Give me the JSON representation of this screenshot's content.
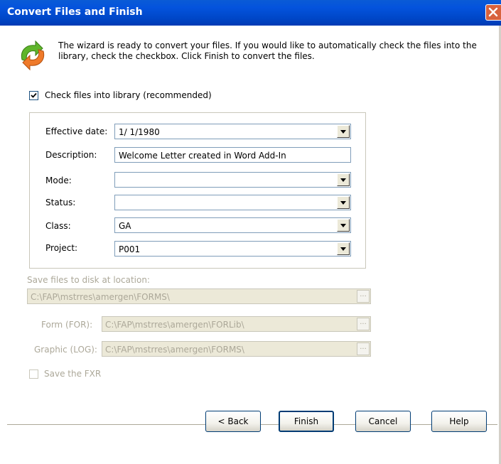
{
  "window": {
    "title": "Convert Files and Finish"
  },
  "intro": {
    "text": "The wizard is ready to convert your files.  If you would like to automatically check the files into the library, check the checkbox.  Click Finish to convert the files."
  },
  "checkin": {
    "label": "Check files into library (recommended)",
    "checked": true
  },
  "fields": {
    "effective_date": {
      "label": "Effective date:",
      "value": "1/  1/1980"
    },
    "description": {
      "label": "Description:",
      "value": "Welcome Letter created in Word Add-In"
    },
    "mode": {
      "label": "Mode:",
      "value": ""
    },
    "status": {
      "label": "Status:",
      "value": ""
    },
    "class": {
      "label": "Class:",
      "value": "GA"
    },
    "project": {
      "label": "Project:",
      "value": "P001"
    }
  },
  "save": {
    "label": "Save files to disk at location:",
    "location": "C:\\FAP\\mstrres\\amergen\\FORMS\\",
    "form_label": "Form (FOR):",
    "form_path": "C:\\FAP\\mstrres\\amergen\\FORLib\\",
    "graphic_label": "Graphic (LOG):",
    "graphic_path": "C:\\FAP\\mstrres\\amergen\\FORMS\\",
    "fxr_label": "Save the FXR",
    "fxr_checked": false
  },
  "browse": {
    "label": "..."
  },
  "buttons": {
    "back": "< Back",
    "finish": "Finish",
    "cancel": "Cancel",
    "help": "Help"
  },
  "colors": {
    "title_bar": "#0453dd",
    "close_button": "#d8623d",
    "disabled_text": "#aca899"
  }
}
